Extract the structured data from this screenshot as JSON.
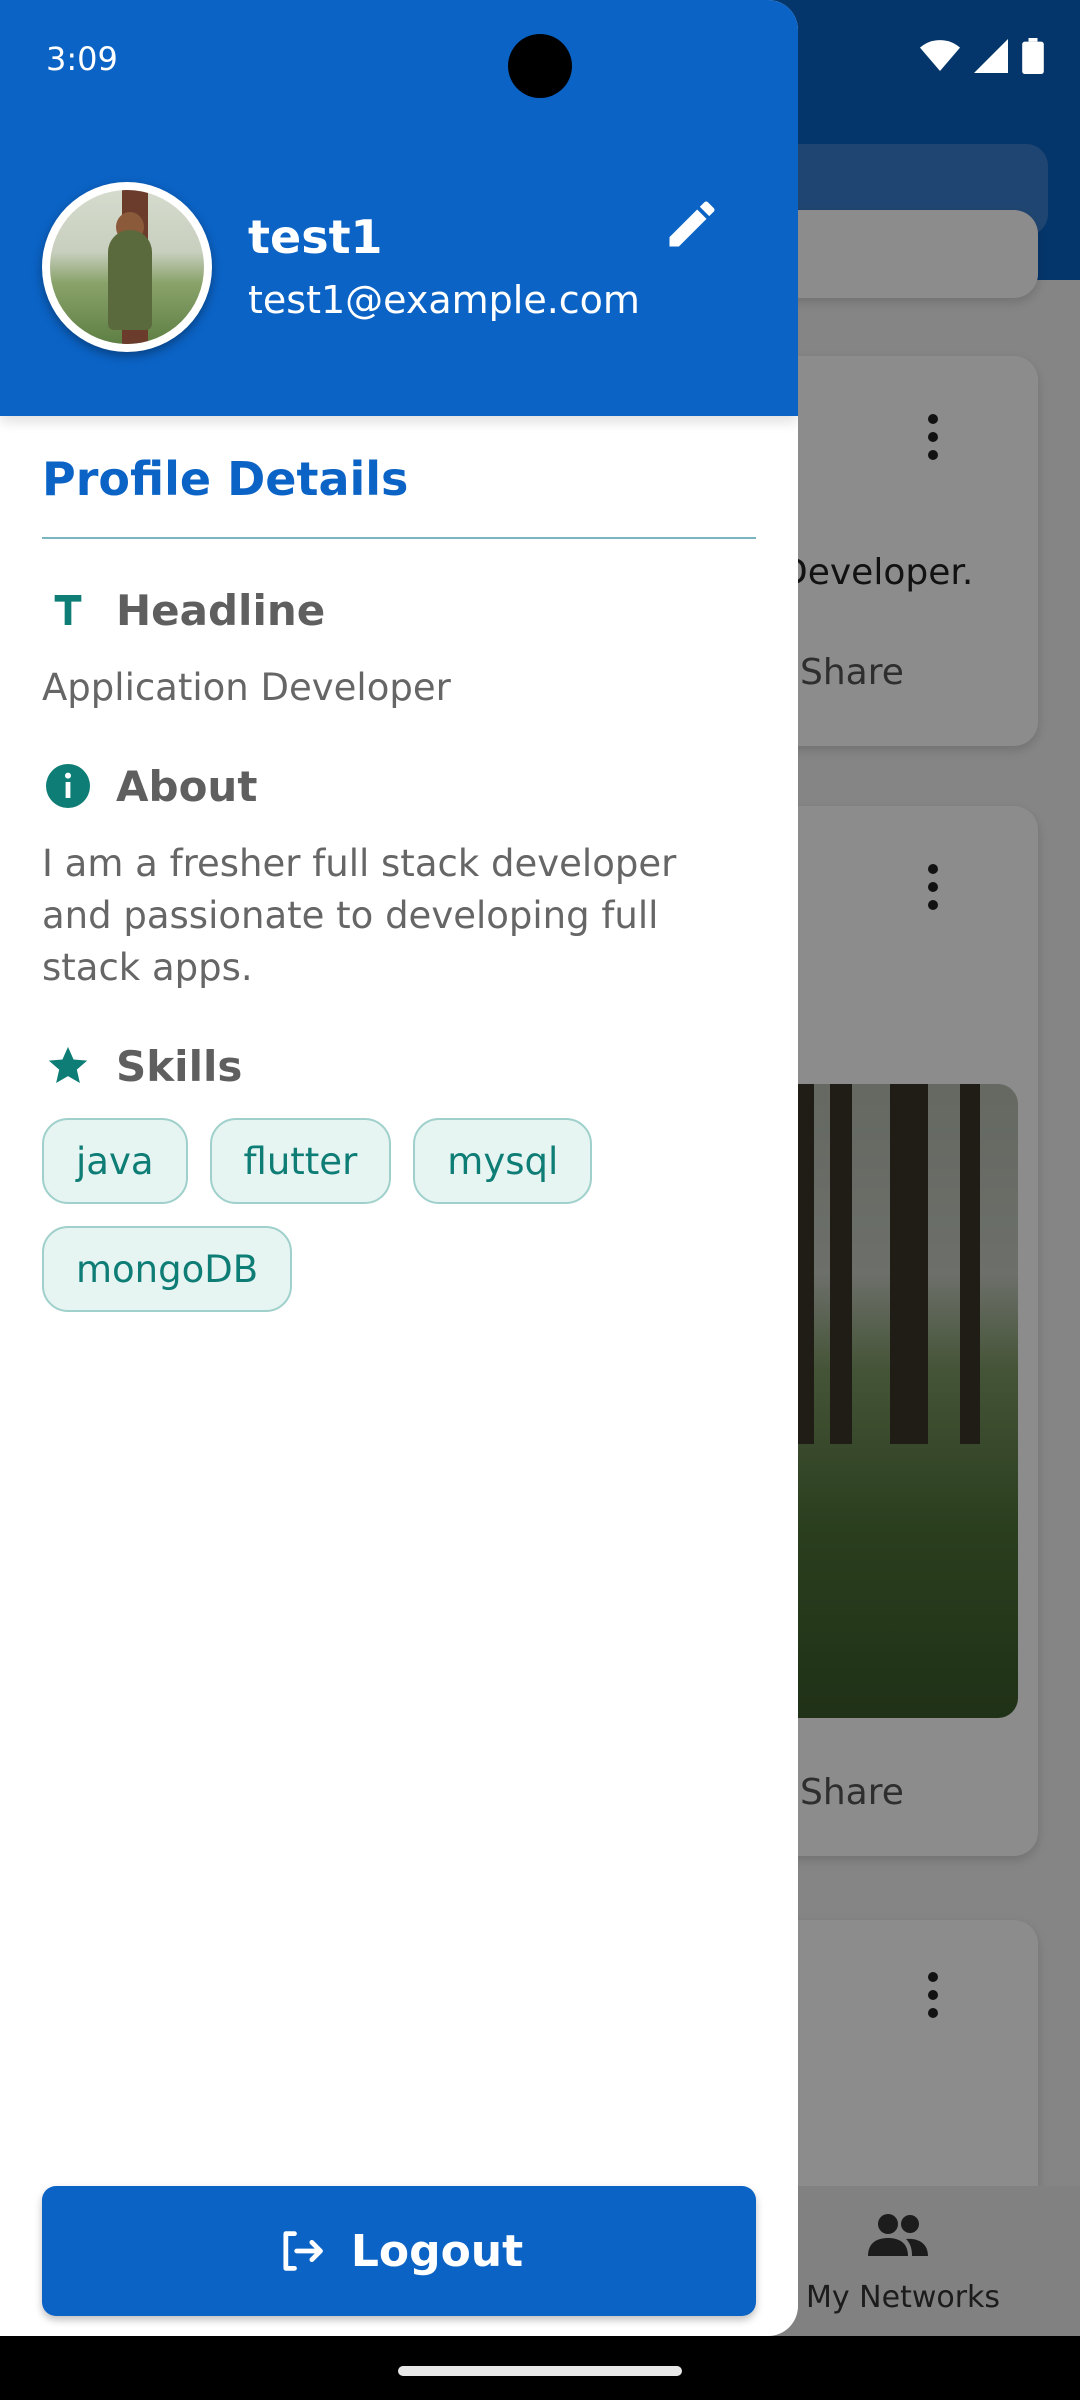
{
  "status_bar": {
    "time": "3:09"
  },
  "drawer": {
    "user": {
      "name": "test1",
      "email": "test1@example.com"
    },
    "section_title": "Profile Details",
    "headline": {
      "label": "Headline",
      "value": "Application Developer",
      "icon": "text-icon"
    },
    "about": {
      "label": "About",
      "value": "I am a fresher full stack developer and passionate to developing full stack apps.",
      "icon": "info-icon"
    },
    "skills": {
      "label": "Skills",
      "icon": "star-icon",
      "items": [
        "java",
        "flutter",
        "mysql",
        "mongoDB"
      ]
    },
    "logout_label": "Logout"
  },
  "background_app": {
    "card1_text": "Developer.",
    "share_label": "Share",
    "bottom_nav_label": "My Networks"
  },
  "colors": {
    "primary": "#0b63c5",
    "teal": "#0e7d75",
    "chip_bg": "#e6f4f2"
  }
}
